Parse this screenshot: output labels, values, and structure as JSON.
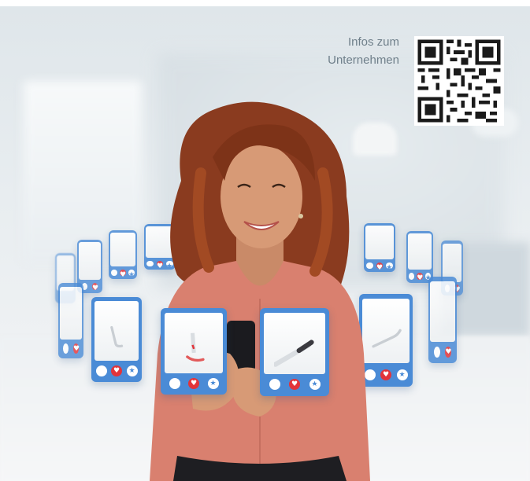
{
  "info": {
    "line1": "Infos zum",
    "line2": "Unternehmen"
  },
  "qr_code": {
    "icon": "qr-code"
  },
  "cards": {
    "buttons": [
      "dislike",
      "like-heart",
      "favorite-star"
    ],
    "colors": {
      "card": "#4a8bd6",
      "heart": "#e2343a",
      "screen": "#ffffff"
    }
  },
  "colors": {
    "info_text": "#6f7f8a",
    "blouse": "#d9806f",
    "hair": "#8a3b1f"
  }
}
